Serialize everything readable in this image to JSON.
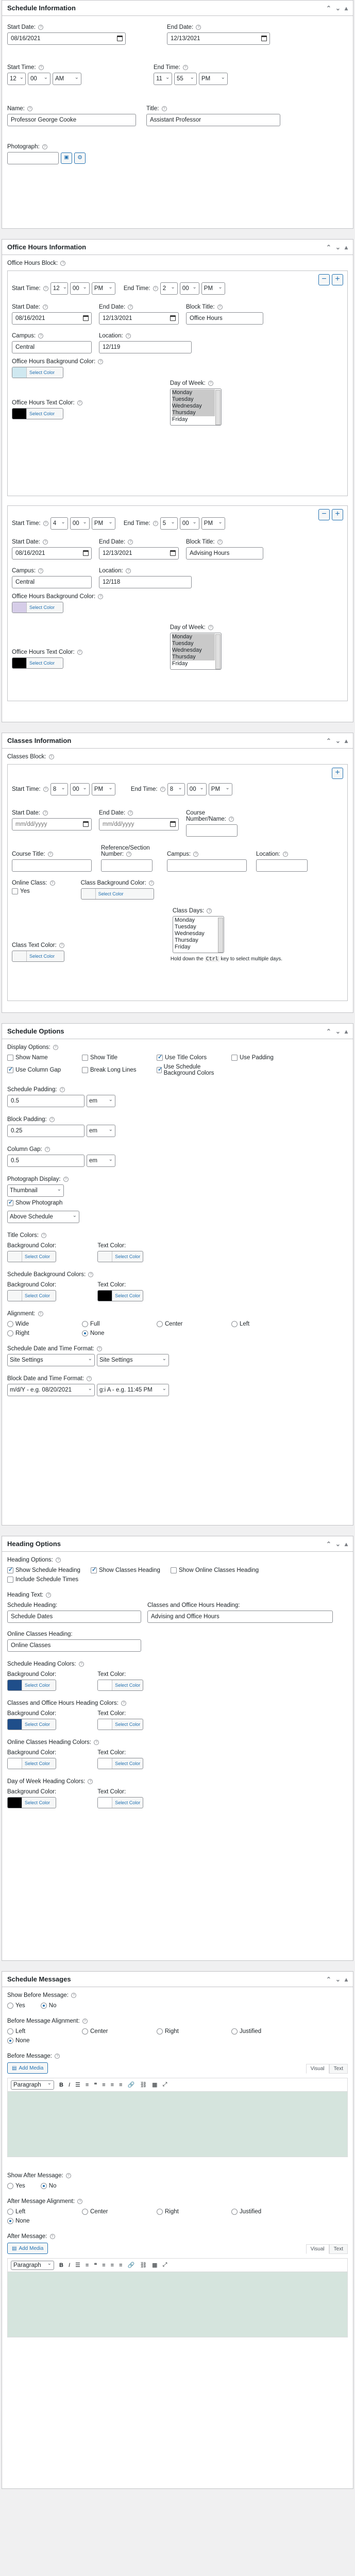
{
  "schedule_info": {
    "title": "Schedule Information",
    "start_date_label": "Start Date:",
    "start_date": "08/16/2021",
    "end_date_label": "End Date:",
    "end_date": "12/13/2021",
    "start_time_label": "Start Time:",
    "start_hour": "12",
    "start_min": "00",
    "start_ampm": "AM",
    "end_time_label": "End Time:",
    "end_hour": "11",
    "end_min": "55",
    "end_ampm": "PM",
    "name_label": "Name:",
    "name": "Professor George Cooke",
    "title_label": "Title:",
    "title_value": "Assistant Professor",
    "photo_label": "Photograph:"
  },
  "office_hours": {
    "title": "Office Hours Information",
    "block_label": "Office Hours Block:",
    "blocks": [
      {
        "start_hour": "12",
        "start_min": "00",
        "start_ampm": "PM",
        "end_hour": "2",
        "end_min": "00",
        "end_ampm": "PM",
        "start_date": "08/16/2021",
        "end_date": "12/13/2021",
        "block_title": "Office Hours",
        "campus": "Central",
        "location": "12/119",
        "bg_color": "#cfe8f0",
        "text_color": "#000000",
        "days": [
          "Monday",
          "Tuesday",
          "Wednesday",
          "Thursday",
          "Friday"
        ],
        "days_sel": [
          0,
          1,
          2,
          3
        ]
      },
      {
        "start_hour": "4",
        "start_min": "00",
        "start_ampm": "PM",
        "end_hour": "5",
        "end_min": "00",
        "end_ampm": "PM",
        "start_date": "08/16/2021",
        "end_date": "12/13/2021",
        "block_title": "Advising Hours",
        "campus": "Central",
        "location": "12/118",
        "bg_color": "#d6cde8",
        "text_color": "#000000",
        "days": [
          "Monday",
          "Tuesday",
          "Wednesday",
          "Thursday",
          "Friday"
        ],
        "days_sel": [
          0,
          1,
          2,
          3
        ]
      }
    ],
    "labels": {
      "start_time": "Start Time:",
      "end_time": "End Time:",
      "start_date": "Start Date:",
      "end_date": "End Date:",
      "block_title": "Block Title:",
      "campus": "Campus:",
      "location": "Location:",
      "bg": "Office Hours Background Color:",
      "text": "Office Hours Text Color:",
      "dow": "Day of Week:"
    },
    "select_color": "Select Color"
  },
  "classes": {
    "title": "Classes Information",
    "block_label": "Classes Block:",
    "start_time_label": "Start Time:",
    "start_hour": "8",
    "start_min": "00",
    "start_ampm": "PM",
    "end_time_label": "End Time:",
    "end_hour": "8",
    "end_min": "00",
    "end_ampm": "PM",
    "start_date_label": "Start Date:",
    "start_date_ph": "mm/dd/yyyy",
    "end_date_label": "End Date:",
    "end_date_ph": "mm/dd/yyyy",
    "course_num_label": "Course Number/Name:",
    "course_title_label": "Course Title:",
    "ref_label": "Reference/Section Number:",
    "campus_label": "Campus:",
    "location_label": "Location:",
    "online_label": "Online Class:",
    "online_yes": "Yes",
    "bg_label": "Class Background Color:",
    "days_label": "Class Days:",
    "days": [
      "Monday",
      "Tuesday",
      "Wednesday",
      "Thursday",
      "Friday"
    ],
    "hint_pre": "Hold down the",
    "hint_key": "Ctrl",
    "hint_post": "key to select multiple days.",
    "text_label": "Class Text Color:"
  },
  "schedule_options": {
    "title": "Schedule Options",
    "display_label": "Display Options:",
    "opts": [
      {
        "label": "Show Name",
        "on": false
      },
      {
        "label": "Show Title",
        "on": false
      },
      {
        "label": "Use Title Colors",
        "on": true
      },
      {
        "label": "Use Padding",
        "on": false
      },
      {
        "label": "Use Column Gap",
        "on": true
      },
      {
        "label": "Break Long Lines",
        "on": false
      },
      {
        "label": "Use Schedule Background Colors",
        "on": true
      }
    ],
    "schedule_padding_label": "Schedule Padding:",
    "schedule_padding": "0.5",
    "schedule_padding_unit": "em",
    "block_padding_label": "Block Padding:",
    "block_padding": "0.25",
    "block_padding_unit": "em",
    "column_gap_label": "Column Gap:",
    "column_gap": "0.5",
    "column_gap_unit": "em",
    "photo_display_label": "Photograph Display:",
    "photo_display": "Thumbnail",
    "show_photo": "Show Photograph",
    "photo_pos": "Above Schedule",
    "title_colors_label": "Title Colors:",
    "bg_color_label": "Background Color:",
    "text_color_label": "Text Color:",
    "select_color": "Select Color",
    "sched_bg_label": "Schedule Background Colors:",
    "alignment_label": "Alignment:",
    "align_opts": [
      {
        "label": "Wide",
        "on": false
      },
      {
        "label": "Full",
        "on": false
      },
      {
        "label": "Center",
        "on": false
      },
      {
        "label": "Left",
        "on": false
      },
      {
        "label": "Right",
        "on": false
      },
      {
        "label": "None",
        "on": true
      }
    ],
    "date_fmt_label": "Schedule Date and Time Format:",
    "date_fmt_a": "Site Settings",
    "date_fmt_b": "Site Settings",
    "block_fmt_label": "Block Date and Time Format:",
    "block_fmt_a": "m/d/Y - e.g. 08/20/2021",
    "block_fmt_b": "g:i A - e.g. 11:45 PM"
  },
  "heading_options": {
    "title": "Heading Options",
    "options_label": "Heading Options:",
    "opts": [
      {
        "label": "Show Schedule Heading",
        "on": true
      },
      {
        "label": "Show Classes Heading",
        "on": true
      },
      {
        "label": "Show Online Classes Heading",
        "on": false
      },
      {
        "label": "Include Schedule Times",
        "on": false
      }
    ],
    "heading_text_label": "Heading Text:",
    "schedule_heading_label": "Schedule Heading:",
    "schedule_heading": "Schedule Dates",
    "classes_oh_label": "Classes and Office Hours Heading:",
    "classes_oh": "Advising and Office Hours",
    "online_label": "Online Classes Heading:",
    "online": "Online Classes",
    "sh_colors": "Schedule Heading Colors:",
    "coh_colors": "Classes and Office Hours Heading Colors:",
    "och_colors": "Online Classes Heading Colors:",
    "dow_colors": "Day of Week Heading Colors:",
    "bg_color_label": "Background Color:",
    "text_color_label": "Text Color:",
    "select_color": "Select Color",
    "colors": {
      "navy": "#1f4e8a",
      "black": "#000000",
      "white": "#ffffff"
    }
  },
  "messages": {
    "title": "Schedule Messages",
    "before_show_label": "Show Before Message:",
    "yes": "Yes",
    "no": "No",
    "before_align_label": "Before Message Alignment:",
    "align": [
      "Left",
      "Center",
      "Right",
      "Justified",
      "None"
    ],
    "before_label": "Before Message:",
    "add_media": "Add Media",
    "visual": "Visual",
    "text": "Text",
    "paragraph": "Paragraph",
    "after_show_label": "Show After Message:",
    "after_align_label": "After Message Alignment:",
    "after_label": "After Message:"
  }
}
